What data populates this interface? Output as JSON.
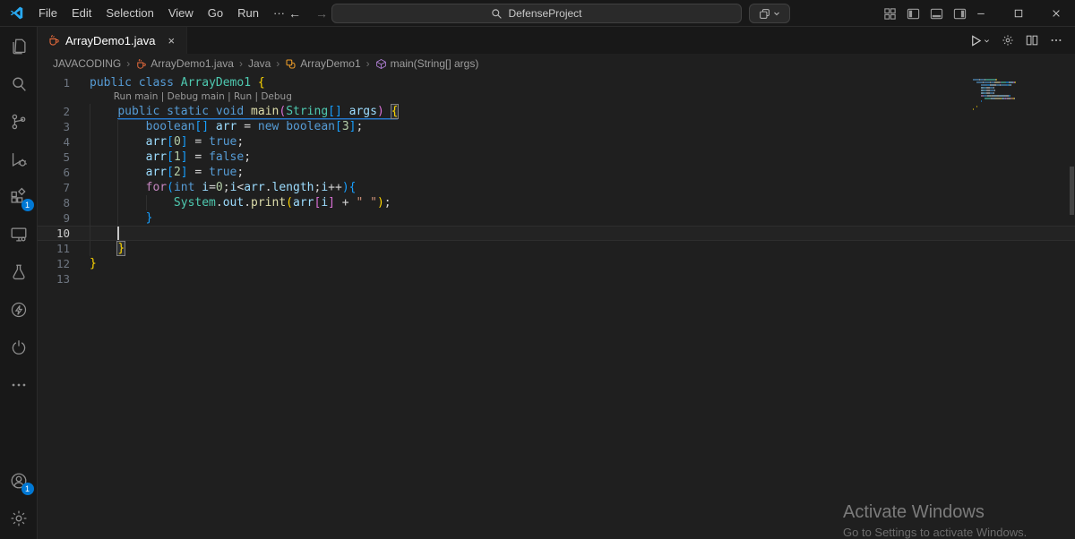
{
  "colors": {
    "accent": "#0078d4",
    "chrome_bg": "#181818",
    "editor_bg": "#1f1f1f"
  },
  "title_bar": {
    "menus": [
      "File",
      "Edit",
      "Selection",
      "View",
      "Go",
      "Run"
    ],
    "overflow_label": "···",
    "search_value": "DefenseProject",
    "icons": [
      "vscode-logo",
      "back-arrow-icon",
      "forward-arrow-icon",
      "search-icon",
      "stacked-squares-icon",
      "chevron-down-icon",
      "customize-layout-icon",
      "layout-sidebar-left-icon",
      "layout-panel-icon",
      "layout-sidebar-right-icon",
      "minimize-icon",
      "maximize-icon",
      "close-icon"
    ]
  },
  "activity_bar": {
    "items": [
      "explorer",
      "search",
      "source-control",
      "run-and-debug",
      "extensions",
      "remote-explorer",
      "testing",
      "lightning-circle",
      "power-circle",
      "more"
    ],
    "extensions_badge": "1",
    "account_badge": "1",
    "bottom_items": [
      "account",
      "settings-gear"
    ]
  },
  "tab_bar": {
    "tabs": [
      {
        "label": "ArrayDemo1.java",
        "icon": "java-file-icon",
        "close": "×",
        "active": true
      }
    ],
    "actions": [
      "run-button",
      "gear-icon",
      "split-editor-icon",
      "more-actions-icon"
    ]
  },
  "breadcrumb": {
    "items": [
      {
        "label": "JAVACODING",
        "icon": null
      },
      {
        "label": "ArrayDemo1.java",
        "icon": "java-file-icon"
      },
      {
        "label": "Java",
        "icon": null
      },
      {
        "label": "ArrayDemo1",
        "icon": "symbol-class-icon"
      },
      {
        "label": "main(String[] args)",
        "icon": "symbol-method-icon"
      }
    ]
  },
  "editor": {
    "codelens_links": [
      "Run main",
      "Debug main",
      "Run",
      "Debug"
    ],
    "codelens_separator": " | ",
    "lines": [
      {
        "num": 1,
        "indent": 0,
        "tokens": [
          [
            "kw",
            "public"
          ],
          [
            "pl",
            " "
          ],
          [
            "kw",
            "class"
          ],
          [
            "pl",
            " "
          ],
          [
            "typ",
            "ArrayDemo1"
          ],
          [
            "pl",
            " "
          ],
          [
            "b1",
            "{"
          ]
        ]
      },
      {
        "num": 2,
        "indent": 1,
        "codelens": true,
        "underline": true,
        "tokens": [
          [
            "kw",
            "public"
          ],
          [
            "pl",
            " "
          ],
          [
            "kw",
            "static"
          ],
          [
            "pl",
            " "
          ],
          [
            "kw",
            "void"
          ],
          [
            "pl",
            " "
          ],
          [
            "fn",
            "main"
          ],
          [
            "b2",
            "("
          ],
          [
            "typ",
            "String"
          ],
          [
            "b3",
            "[]"
          ],
          [
            "pl",
            " "
          ],
          [
            "var",
            "args"
          ],
          [
            "b2",
            ")"
          ],
          [
            "pl",
            " "
          ],
          [
            "b1 boxed",
            "{"
          ]
        ]
      },
      {
        "num": 3,
        "indent": 2,
        "tokens": [
          [
            "kw",
            "boolean"
          ],
          [
            "b3",
            "[]"
          ],
          [
            "pl",
            " "
          ],
          [
            "var",
            "arr"
          ],
          [
            "pl",
            " "
          ],
          [
            "op",
            "="
          ],
          [
            "pl",
            " "
          ],
          [
            "kw",
            "new"
          ],
          [
            "pl",
            " "
          ],
          [
            "kw",
            "boolean"
          ],
          [
            "b3",
            "["
          ],
          [
            "num",
            "3"
          ],
          [
            "b3",
            "]"
          ],
          [
            "pl",
            ";"
          ]
        ]
      },
      {
        "num": 4,
        "indent": 2,
        "tokens": [
          [
            "var",
            "arr"
          ],
          [
            "b3",
            "["
          ],
          [
            "num",
            "0"
          ],
          [
            "b3",
            "]"
          ],
          [
            "pl",
            " "
          ],
          [
            "op",
            "="
          ],
          [
            "pl",
            " "
          ],
          [
            "kw",
            "true"
          ],
          [
            "pl",
            ";"
          ]
        ]
      },
      {
        "num": 5,
        "indent": 2,
        "tokens": [
          [
            "var",
            "arr"
          ],
          [
            "b3",
            "["
          ],
          [
            "num",
            "1"
          ],
          [
            "b3",
            "]"
          ],
          [
            "pl",
            " "
          ],
          [
            "op",
            "="
          ],
          [
            "pl",
            " "
          ],
          [
            "kw",
            "false"
          ],
          [
            "pl",
            ";"
          ]
        ]
      },
      {
        "num": 6,
        "indent": 2,
        "tokens": [
          [
            "var",
            "arr"
          ],
          [
            "b3",
            "["
          ],
          [
            "num",
            "2"
          ],
          [
            "b3",
            "]"
          ],
          [
            "pl",
            " "
          ],
          [
            "op",
            "="
          ],
          [
            "pl",
            " "
          ],
          [
            "kw",
            "true"
          ],
          [
            "pl",
            ";"
          ]
        ]
      },
      {
        "num": 7,
        "indent": 2,
        "tokens": [
          [
            "ctl",
            "for"
          ],
          [
            "b3",
            "("
          ],
          [
            "kw",
            "int"
          ],
          [
            "pl",
            " "
          ],
          [
            "var",
            "i"
          ],
          [
            "op",
            "="
          ],
          [
            "num",
            "0"
          ],
          [
            "pl",
            ";"
          ],
          [
            "var",
            "i"
          ],
          [
            "op",
            "<"
          ],
          [
            "var",
            "arr"
          ],
          [
            "pl",
            "."
          ],
          [
            "var",
            "length"
          ],
          [
            "pl",
            ";"
          ],
          [
            "var",
            "i"
          ],
          [
            "op",
            "++"
          ],
          [
            "b3",
            ")"
          ],
          [
            "b3",
            "{"
          ]
        ]
      },
      {
        "num": 8,
        "indent": 3,
        "tokens": [
          [
            "typ",
            "System"
          ],
          [
            "pl",
            "."
          ],
          [
            "var",
            "out"
          ],
          [
            "pl",
            "."
          ],
          [
            "fn",
            "print"
          ],
          [
            "b1",
            "("
          ],
          [
            "var",
            "arr"
          ],
          [
            "b2",
            "["
          ],
          [
            "var",
            "i"
          ],
          [
            "b2",
            "]"
          ],
          [
            "pl",
            " "
          ],
          [
            "op",
            "+"
          ],
          [
            "pl",
            " "
          ],
          [
            "str",
            "\" \""
          ],
          [
            "b1",
            ")"
          ],
          [
            "pl",
            ";"
          ]
        ]
      },
      {
        "num": 9,
        "indent": 2,
        "tokens": [
          [
            "b3",
            "}"
          ]
        ]
      },
      {
        "num": 10,
        "indent": 1,
        "current": true,
        "cursor": true,
        "tokens": []
      },
      {
        "num": 11,
        "indent": 1,
        "tokens": [
          [
            "b1 boxed",
            "}"
          ]
        ]
      },
      {
        "num": 12,
        "indent": 0,
        "tokens": [
          [
            "b1",
            "}"
          ]
        ]
      },
      {
        "num": 13,
        "indent": 0,
        "tokens": []
      }
    ]
  },
  "watermark": {
    "title": "Activate Windows",
    "subtitle": "Go to Settings to activate Windows."
  }
}
